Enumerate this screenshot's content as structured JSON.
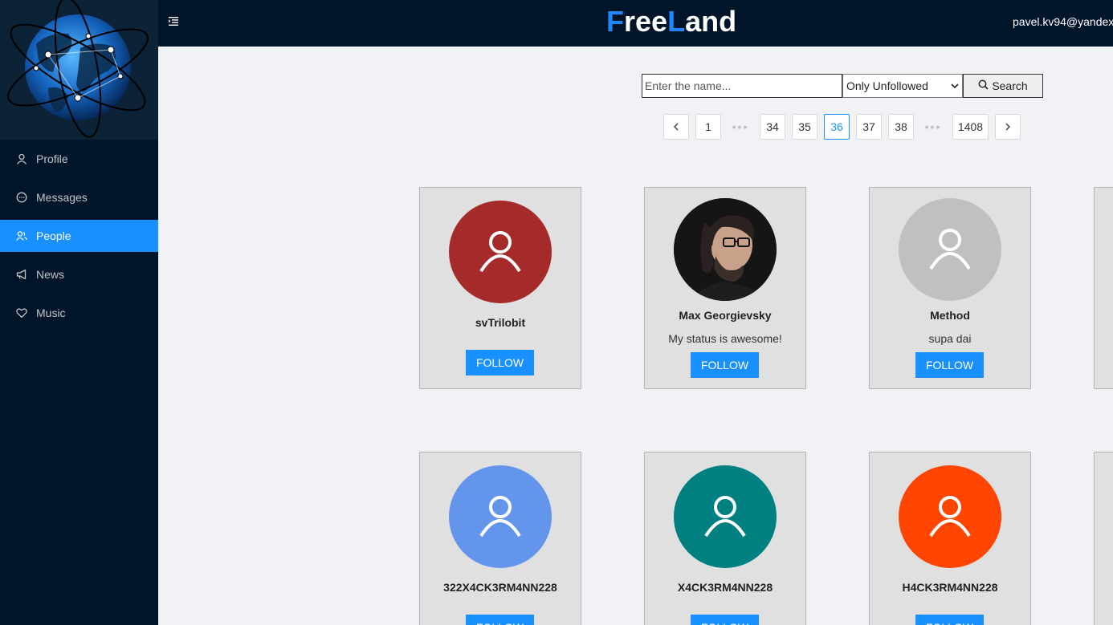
{
  "header": {
    "brand_parts": [
      "F",
      "ree",
      "L",
      "and"
    ],
    "user_email": "pavel.kv94@yandex."
  },
  "sidebar": {
    "items": [
      {
        "label": "Profile",
        "icon": "user-icon",
        "active": false
      },
      {
        "label": "Messages",
        "icon": "message-icon",
        "active": false
      },
      {
        "label": "People",
        "icon": "people-icon",
        "active": true
      },
      {
        "label": "News",
        "icon": "notification-icon",
        "active": false
      },
      {
        "label": "Music",
        "icon": "heart-icon",
        "active": false
      }
    ]
  },
  "search": {
    "placeholder": "Enter the name...",
    "filter_value": "Only Unfollowed",
    "button_label": "Search"
  },
  "pagination": {
    "prev": "<",
    "next": ">",
    "ellipsis": "•••",
    "pages": [
      "1",
      "34",
      "35",
      "36",
      "37",
      "38",
      "1408"
    ],
    "current": "36"
  },
  "users": [
    {
      "name": "svTrilobit",
      "status": "",
      "avatar_color": "#a52a2a",
      "photo": false,
      "follow_label": "FOLLOW"
    },
    {
      "name": "Max Georgievsky",
      "status": "My status is awesome!",
      "avatar_color": "#1a1a1a",
      "photo": true,
      "follow_label": "FOLLOW"
    },
    {
      "name": "Method",
      "status": "supa dai",
      "avatar_color": "#c0c0c0",
      "photo": false,
      "follow_label": "FOLLOW"
    },
    {
      "name": "322X4CK3RM4NN228",
      "status": "",
      "avatar_color": "#6495ed",
      "photo": false,
      "follow_label": "FOLLOW"
    },
    {
      "name": "X4CK3RM4NN228",
      "status": "",
      "avatar_color": "#008080",
      "photo": false,
      "follow_label": "FOLLOW"
    },
    {
      "name": "H4CK3RM4NN228",
      "status": "",
      "avatar_color": "#ff4500",
      "photo": false,
      "follow_label": "FOLLOW"
    }
  ],
  "colors": {
    "sidebar_bg": "#001529",
    "accent": "#1890ff",
    "card_bg": "#e0e0e0"
  }
}
